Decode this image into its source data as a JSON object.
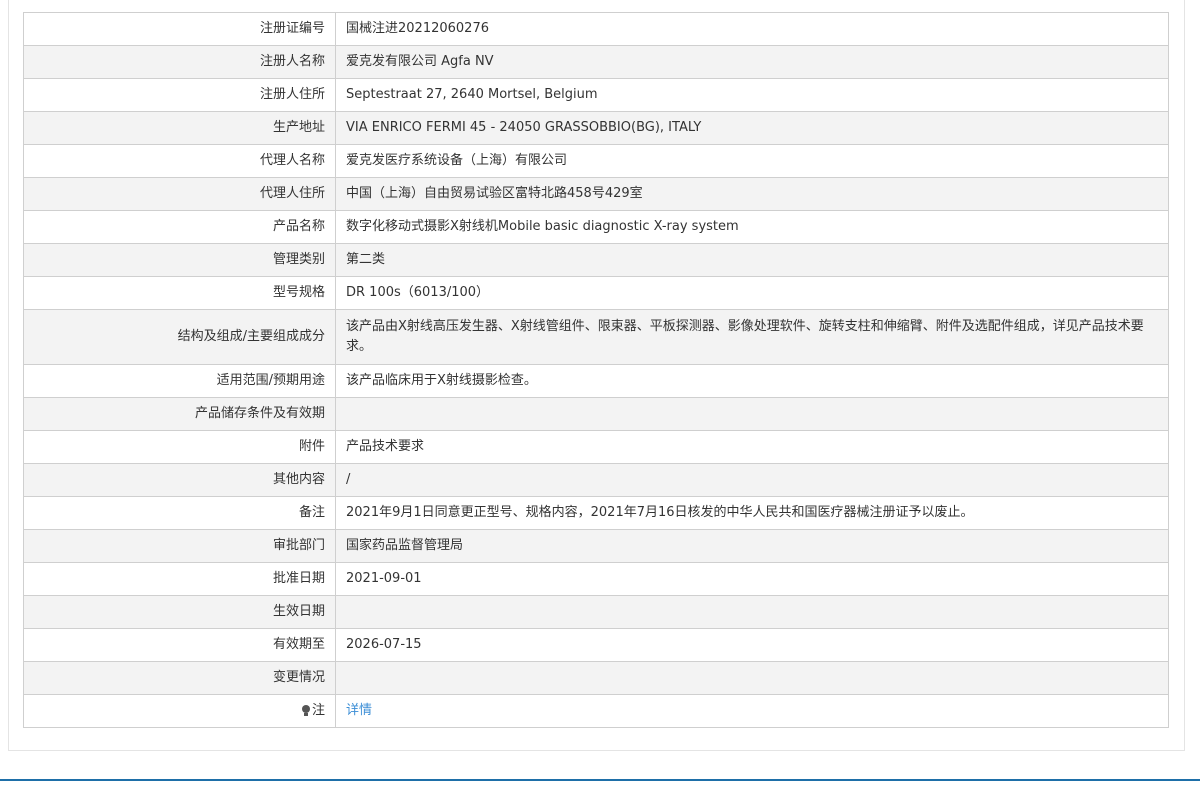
{
  "rows": [
    {
      "label": "注册证编号",
      "value": "国械注进20212060276"
    },
    {
      "label": "注册人名称",
      "value": "爱克发有限公司 Agfa NV"
    },
    {
      "label": "注册人住所",
      "value": "Septestraat 27, 2640 Mortsel, Belgium"
    },
    {
      "label": "生产地址",
      "value": "VIA ENRICO FERMI 45 - 24050 GRASSOBBIO(BG), ITALY"
    },
    {
      "label": "代理人名称",
      "value": "爱克发医疗系统设备（上海）有限公司"
    },
    {
      "label": "代理人住所",
      "value": "中国（上海）自由贸易试验区富特北路458号429室"
    },
    {
      "label": "产品名称",
      "value": "数字化移动式摄影X射线机Mobile basic diagnostic X-ray system"
    },
    {
      "label": "管理类别",
      "value": "第二类"
    },
    {
      "label": "型号规格",
      "value": "DR 100s（6013/100）"
    },
    {
      "label": "结构及组成/主要组成成分",
      "value": "该产品由X射线高压发生器、X射线管组件、限束器、平板探测器、影像处理软件、旋转支柱和伸缩臂、附件及选配件组成，详见产品技术要求。"
    },
    {
      "label": "适用范围/预期用途",
      "value": "该产品临床用于X射线摄影检查。"
    },
    {
      "label": "产品储存条件及有效期",
      "value": ""
    },
    {
      "label": "附件",
      "value": "产品技术要求"
    },
    {
      "label": "其他内容",
      "value": "/"
    },
    {
      "label": "备注",
      "value": "2021年9月1日同意更正型号、规格内容，2021年7月16日核发的中华人民共和国医疗器械注册证予以废止。"
    },
    {
      "label": "审批部门",
      "value": "国家药品监督管理局"
    },
    {
      "label": "批准日期",
      "value": "2021-09-01"
    },
    {
      "label": "生效日期",
      "value": ""
    },
    {
      "label": "有效期至",
      "value": "2026-07-15"
    },
    {
      "label": "变更情况",
      "value": ""
    },
    {
      "label": "注",
      "value": "详情"
    }
  ],
  "colors": {
    "link": "#3b8ed6",
    "stripe": "#f3f3f3",
    "border": "#cfcfcf",
    "footer": "#1e6fa8"
  },
  "icons": {
    "note": "lightbulb-icon"
  }
}
